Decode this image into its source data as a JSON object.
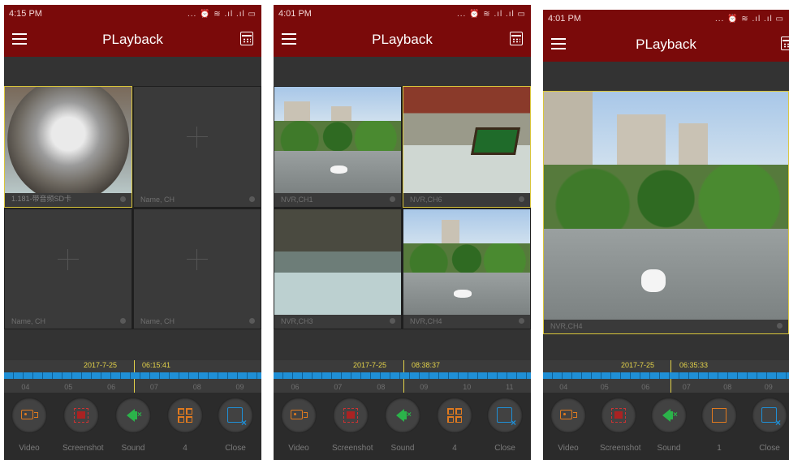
{
  "app_title": "PLayback",
  "screens": [
    {
      "time": "4:15 PM",
      "status_icons": "... ⏰ ≋ .ıl .ıl ▭",
      "cells": [
        {
          "label": "1.181-带音频SD卡",
          "has_video": true,
          "selected": true
        },
        {
          "label": "Name, CH",
          "has_video": false,
          "selected": false
        },
        {
          "label": "Name, CH",
          "has_video": false,
          "selected": false
        },
        {
          "label": "Name, CH",
          "has_video": false,
          "selected": false
        }
      ],
      "timeline": {
        "date": "2017-7-25",
        "time": "06:15:41",
        "ticks": [
          "04",
          "05",
          "06",
          "07",
          "08",
          "09"
        ]
      },
      "controls": [
        {
          "label": "Video",
          "icon": "video-icon"
        },
        {
          "label": "Screenshot",
          "icon": "screenshot-icon"
        },
        {
          "label": "Sound",
          "icon": "sound-muted-icon"
        },
        {
          "label": "4",
          "icon": "grid-4-icon"
        },
        {
          "label": "Close",
          "icon": "close-icon"
        }
      ]
    },
    {
      "time": "4:01 PM",
      "status_icons": "... ⏰ ≋ .ıl .ıl ▭",
      "cells": [
        {
          "label": "NVR,CH1",
          "has_video": true,
          "selected": false
        },
        {
          "label": "NVR,CH6",
          "has_video": true,
          "selected": true
        },
        {
          "label": "NVR,CH3",
          "has_video": true,
          "selected": false
        },
        {
          "label": "NVR,CH4",
          "has_video": true,
          "selected": false
        }
      ],
      "timeline": {
        "date": "2017-7-25",
        "time": "08:38:37",
        "ticks": [
          "06",
          "07",
          "08",
          "09",
          "10",
          "11"
        ]
      },
      "controls": [
        {
          "label": "Video",
          "icon": "video-icon"
        },
        {
          "label": "Screenshot",
          "icon": "screenshot-icon"
        },
        {
          "label": "Sound",
          "icon": "sound-muted-icon"
        },
        {
          "label": "4",
          "icon": "grid-4-icon"
        },
        {
          "label": "Close",
          "icon": "close-icon"
        }
      ]
    },
    {
      "time": "4:01 PM",
      "status_icons": "... ⏰ ≋ .ıl .ıl ▭",
      "cells": [
        {
          "label": "NVR,CH4",
          "has_video": true,
          "selected": true
        }
      ],
      "timeline": {
        "date": "2017-7-25",
        "time": "06:35:33",
        "ticks": [
          "04",
          "05",
          "06",
          "07",
          "08",
          "09"
        ]
      },
      "controls": [
        {
          "label": "Video",
          "icon": "video-icon"
        },
        {
          "label": "Screenshot",
          "icon": "screenshot-icon"
        },
        {
          "label": "Sound",
          "icon": "sound-muted-icon"
        },
        {
          "label": "1",
          "icon": "single-view-icon"
        },
        {
          "label": "Close",
          "icon": "close-icon"
        }
      ]
    }
  ]
}
